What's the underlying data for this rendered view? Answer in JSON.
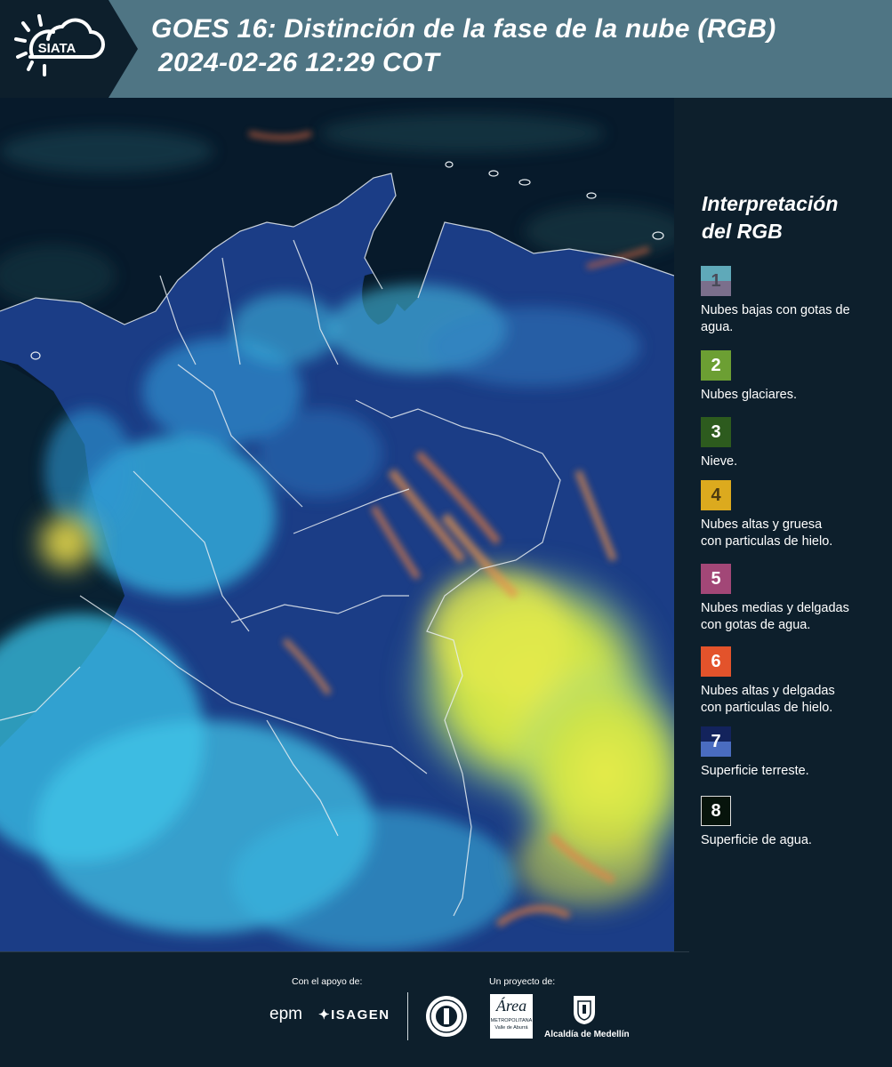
{
  "header": {
    "logo_text": "SIATA",
    "title_line1": "GOES 16: Distinción de la fase de la nube (RGB)",
    "title_line2": "2024-02-26 12:29 COT"
  },
  "legend": {
    "title_line1": "Interpretación",
    "title_line2": "del RGB",
    "items": [
      {
        "num": "1",
        "label_line1": "Nubes bajas con gotas de",
        "label_line2": "agua.",
        "color_top": "#5fa9b9",
        "color_bottom": "#7b6f8c"
      },
      {
        "num": "2",
        "label_line1": "Nubes glaciares.",
        "label_line2": "",
        "color_top": "#6c9f33",
        "color_bottom": "#6c9f33"
      },
      {
        "num": "3",
        "label_line1": "Nieve.",
        "label_line2": "",
        "color_top": "#2d5b1e",
        "color_bottom": "#2d5b1e"
      },
      {
        "num": "4",
        "label_line1": "Nubes altas y gruesa",
        "label_line2": "con particulas de hielo.",
        "color_top": "#dcaa1e",
        "color_bottom": "#dcaa1e"
      },
      {
        "num": "5",
        "label_line1": "Nubes medias y delgadas",
        "label_line2": "con gotas de agua.",
        "color_top": "#a24777",
        "color_bottom": "#a24777"
      },
      {
        "num": "6",
        "label_line1": "Nubes altas y delgadas",
        "label_line2": "con particulas de hielo.",
        "color_top": "#e3532b",
        "color_bottom": "#e3532b"
      },
      {
        "num": "7",
        "label_line1": "Superficie terreste.",
        "label_line2": "",
        "color_top": "#13235c",
        "color_bottom": "#4a6cc0"
      },
      {
        "num": "8",
        "label_line1": "Superficie de agua.",
        "label_line2": "",
        "color_top": "#07140c",
        "color_bottom": "#07140c"
      }
    ]
  },
  "footer": {
    "support_label": "Con el apoyo de:",
    "project_label": "Un proyecto de:",
    "sponsor1": "epm",
    "sponsor2": "ISAGEN",
    "partner_area": "Área",
    "partner_area_sub1": "METROPOLITANA",
    "partner_area_sub2": "Valle de Aburrá",
    "partner_alcaldia": "Alcaldía de Medellín"
  },
  "colors": {
    "header_bg": "#4f7584",
    "panel_bg": "#0d1f2c",
    "water": "#071a2b",
    "land": "#1b3d86",
    "cloud_cyan": "#3ec6e6",
    "cloud_yellow": "#d8e64a",
    "cloud_orange": "#e0824a"
  }
}
